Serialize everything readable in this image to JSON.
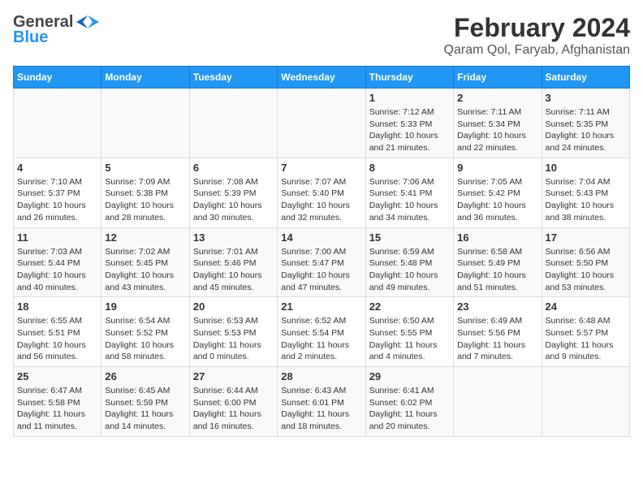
{
  "header": {
    "logo_general": "General",
    "logo_blue": "Blue",
    "title": "February 2024",
    "subtitle": "Qaram Qol, Faryab, Afghanistan"
  },
  "days_of_week": [
    "Sunday",
    "Monday",
    "Tuesday",
    "Wednesday",
    "Thursday",
    "Friday",
    "Saturday"
  ],
  "weeks": [
    [
      {
        "day": "",
        "info": ""
      },
      {
        "day": "",
        "info": ""
      },
      {
        "day": "",
        "info": ""
      },
      {
        "day": "",
        "info": ""
      },
      {
        "day": "1",
        "sunrise": "7:12 AM",
        "sunset": "5:33 PM",
        "daylight": "10 hours and 21 minutes."
      },
      {
        "day": "2",
        "sunrise": "7:11 AM",
        "sunset": "5:34 PM",
        "daylight": "10 hours and 22 minutes."
      },
      {
        "day": "3",
        "sunrise": "7:11 AM",
        "sunset": "5:35 PM",
        "daylight": "10 hours and 24 minutes."
      }
    ],
    [
      {
        "day": "4",
        "sunrise": "7:10 AM",
        "sunset": "5:37 PM",
        "daylight": "10 hours and 26 minutes."
      },
      {
        "day": "5",
        "sunrise": "7:09 AM",
        "sunset": "5:38 PM",
        "daylight": "10 hours and 28 minutes."
      },
      {
        "day": "6",
        "sunrise": "7:08 AM",
        "sunset": "5:39 PM",
        "daylight": "10 hours and 30 minutes."
      },
      {
        "day": "7",
        "sunrise": "7:07 AM",
        "sunset": "5:40 PM",
        "daylight": "10 hours and 32 minutes."
      },
      {
        "day": "8",
        "sunrise": "7:06 AM",
        "sunset": "5:41 PM",
        "daylight": "10 hours and 34 minutes."
      },
      {
        "day": "9",
        "sunrise": "7:05 AM",
        "sunset": "5:42 PM",
        "daylight": "10 hours and 36 minutes."
      },
      {
        "day": "10",
        "sunrise": "7:04 AM",
        "sunset": "5:43 PM",
        "daylight": "10 hours and 38 minutes."
      }
    ],
    [
      {
        "day": "11",
        "sunrise": "7:03 AM",
        "sunset": "5:44 PM",
        "daylight": "10 hours and 40 minutes."
      },
      {
        "day": "12",
        "sunrise": "7:02 AM",
        "sunset": "5:45 PM",
        "daylight": "10 hours and 43 minutes."
      },
      {
        "day": "13",
        "sunrise": "7:01 AM",
        "sunset": "5:46 PM",
        "daylight": "10 hours and 45 minutes."
      },
      {
        "day": "14",
        "sunrise": "7:00 AM",
        "sunset": "5:47 PM",
        "daylight": "10 hours and 47 minutes."
      },
      {
        "day": "15",
        "sunrise": "6:59 AM",
        "sunset": "5:48 PM",
        "daylight": "10 hours and 49 minutes."
      },
      {
        "day": "16",
        "sunrise": "6:58 AM",
        "sunset": "5:49 PM",
        "daylight": "10 hours and 51 minutes."
      },
      {
        "day": "17",
        "sunrise": "6:56 AM",
        "sunset": "5:50 PM",
        "daylight": "10 hours and 53 minutes."
      }
    ],
    [
      {
        "day": "18",
        "sunrise": "6:55 AM",
        "sunset": "5:51 PM",
        "daylight": "10 hours and 56 minutes."
      },
      {
        "day": "19",
        "sunrise": "6:54 AM",
        "sunset": "5:52 PM",
        "daylight": "10 hours and 58 minutes."
      },
      {
        "day": "20",
        "sunrise": "6:53 AM",
        "sunset": "5:53 PM",
        "daylight": "11 hours and 0 minutes."
      },
      {
        "day": "21",
        "sunrise": "6:52 AM",
        "sunset": "5:54 PM",
        "daylight": "11 hours and 2 minutes."
      },
      {
        "day": "22",
        "sunrise": "6:50 AM",
        "sunset": "5:55 PM",
        "daylight": "11 hours and 4 minutes."
      },
      {
        "day": "23",
        "sunrise": "6:49 AM",
        "sunset": "5:56 PM",
        "daylight": "11 hours and 7 minutes."
      },
      {
        "day": "24",
        "sunrise": "6:48 AM",
        "sunset": "5:57 PM",
        "daylight": "11 hours and 9 minutes."
      }
    ],
    [
      {
        "day": "25",
        "sunrise": "6:47 AM",
        "sunset": "5:58 PM",
        "daylight": "11 hours and 11 minutes."
      },
      {
        "day": "26",
        "sunrise": "6:45 AM",
        "sunset": "5:59 PM",
        "daylight": "11 hours and 14 minutes."
      },
      {
        "day": "27",
        "sunrise": "6:44 AM",
        "sunset": "6:00 PM",
        "daylight": "11 hours and 16 minutes."
      },
      {
        "day": "28",
        "sunrise": "6:43 AM",
        "sunset": "6:01 PM",
        "daylight": "11 hours and 18 minutes."
      },
      {
        "day": "29",
        "sunrise": "6:41 AM",
        "sunset": "6:02 PM",
        "daylight": "11 hours and 20 minutes."
      },
      {
        "day": "",
        "info": ""
      },
      {
        "day": "",
        "info": ""
      }
    ]
  ],
  "labels": {
    "sunrise": "Sunrise:",
    "sunset": "Sunset:",
    "daylight": "Daylight:"
  }
}
